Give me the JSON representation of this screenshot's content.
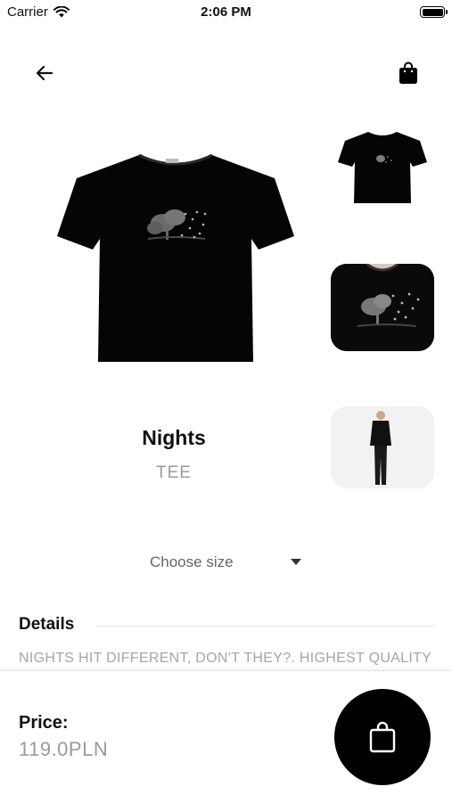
{
  "status_bar": {
    "carrier": "Carrier",
    "time": "2:06 PM"
  },
  "nav": {
    "back_icon": "arrow-left-icon",
    "cart_icon": "shopping-bag-icon"
  },
  "product": {
    "name": "Nights",
    "type": "TEE",
    "images": [
      "front-view",
      "print-closeup",
      "model-full-body"
    ]
  },
  "size_select": {
    "placeholder": "Choose size"
  },
  "details": {
    "title": "Details",
    "text": "NIGHTS HIT DIFFERENT, DON'T THEY?. HIGHEST QUALITY T-SHIRT"
  },
  "footer": {
    "price_label": "Price:",
    "price_value": "119.0PLN",
    "add_to_cart_icon": "shopping-bag-icon"
  },
  "colors": {
    "accent": "#000000",
    "muted_text": "#9a9a9a",
    "background": "#ffffff"
  }
}
